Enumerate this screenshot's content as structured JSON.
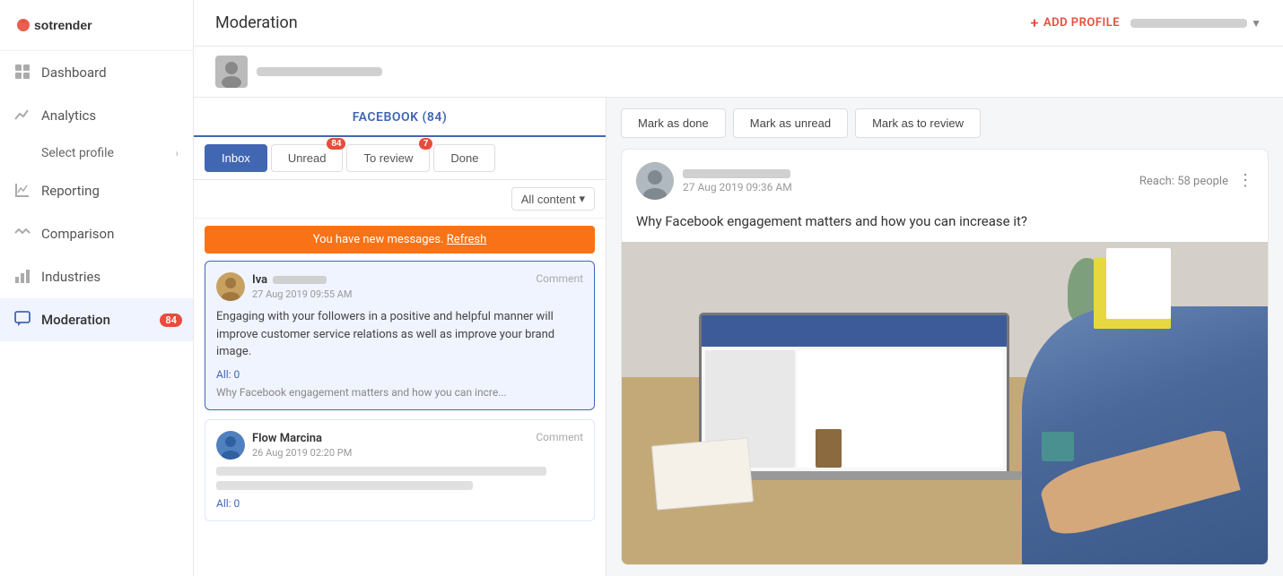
{
  "sidebar": {
    "logo_text": "sotrender",
    "items": [
      {
        "id": "dashboard",
        "label": "Dashboard",
        "icon": "grid-icon",
        "active": false
      },
      {
        "id": "analytics",
        "label": "Analytics",
        "icon": "chart-icon",
        "active": false
      },
      {
        "id": "select-profile",
        "label": "Select profile",
        "sub": true
      },
      {
        "id": "reporting",
        "label": "Reporting",
        "icon": "reporting-icon",
        "active": false
      },
      {
        "id": "comparison",
        "label": "Comparison",
        "icon": "comparison-icon",
        "active": false
      },
      {
        "id": "industries",
        "label": "Industries",
        "icon": "industries-icon",
        "active": false
      },
      {
        "id": "moderation",
        "label": "Moderation",
        "icon": "chat-icon",
        "active": true,
        "badge": "84"
      }
    ]
  },
  "topbar": {
    "page_title": "Moderation",
    "add_profile_label": "ADD PROFILE",
    "add_profile_plus": "+"
  },
  "left_panel": {
    "facebook_label": "FACEBOOK (84)",
    "tabs": [
      {
        "id": "inbox",
        "label": "Inbox",
        "active": true,
        "badge": null
      },
      {
        "id": "unread",
        "label": "Unread",
        "active": false,
        "badge": "84"
      },
      {
        "id": "to-review",
        "label": "To review",
        "active": false,
        "badge": "7"
      },
      {
        "id": "done",
        "label": "Done",
        "active": false,
        "badge": null
      }
    ],
    "filter_label": "All content",
    "new_messages_text": "You have new messages.",
    "refresh_label": "Refresh",
    "messages": [
      {
        "id": "msg1",
        "author": "Iva",
        "time": "27 Aug 2019 09:55 AM",
        "type": "Comment",
        "body": "Engaging with your followers in a positive and helpful manner will improve customer service relations as well as improve your brand image.",
        "link_label": "All: 0",
        "post_ref": "Why Facebook engagement matters and how you can incre...",
        "selected": true
      },
      {
        "id": "msg2",
        "author": "Flow Marcina",
        "time": "26 Aug 2019 02:20 PM",
        "type": "Comment",
        "body": "",
        "link_label": "All: 0",
        "post_ref": "",
        "selected": false
      }
    ]
  },
  "right_panel": {
    "action_buttons": [
      {
        "id": "mark-done",
        "label": "Mark as done"
      },
      {
        "id": "mark-unread",
        "label": "Mark as unread"
      },
      {
        "id": "mark-review",
        "label": "Mark as to review"
      }
    ],
    "post": {
      "author_time": "27 Aug 2019 09:36 AM",
      "reach_label": "Reach: 58 people",
      "title": "Why Facebook engagement matters and how you can increase it?"
    }
  }
}
